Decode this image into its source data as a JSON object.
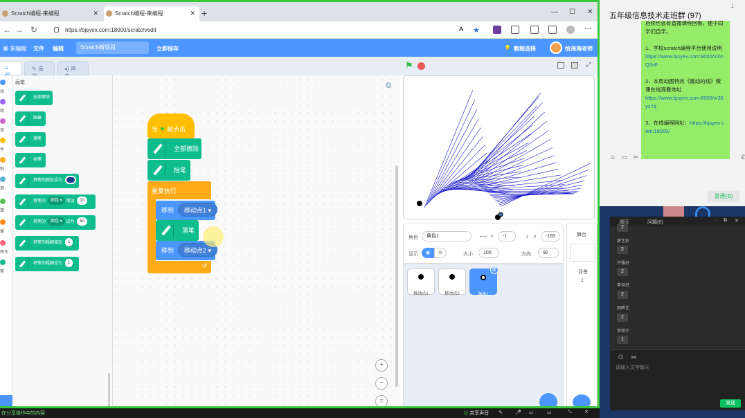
{
  "browser": {
    "tab1_title": "Scratch编程-来编程",
    "tab2_title": "Scratch编程-来编程",
    "url": "https://bjsyex.com:18000/scratch/edit"
  },
  "menubar": {
    "file": "文件",
    "edit": "编辑",
    "project_title": "Scratch新项目",
    "save_now": "立即保存",
    "tutorials": "教程选择",
    "user": "恰海海老师"
  },
  "tabs": {
    "code": "代码",
    "costumes": "造型",
    "sounds": "声音"
  },
  "categories": [
    "动",
    "观",
    "音",
    "件",
    "制",
    "测",
    "算",
    "量",
    "积木",
    "笔"
  ],
  "palette": {
    "heading": "画笔",
    "blocks": [
      {
        "text": "全部擦除"
      },
      {
        "text": "图章"
      },
      {
        "text": "落笔"
      },
      {
        "text": "抬笔"
      },
      {
        "text": "将笔的颜色设为"
      },
      {
        "text": "将笔的",
        "dd": "颜色",
        "mid": "增加",
        "val": "10"
      },
      {
        "text": "将笔的",
        "dd": "颜色",
        "mid": "设为",
        "val": "50"
      },
      {
        "text": "将笔的粗细增加",
        "val": "1"
      },
      {
        "text": "将笔的粗细设为",
        "val": "1"
      }
    ]
  },
  "script": {
    "hat": {
      "when": "当",
      "clicked": "被点击"
    },
    "clear": "全部擦除",
    "pen_up": "抬笔",
    "forever": "重复执行",
    "goto1": {
      "label": "移到",
      "target": "移动点1"
    },
    "pen_down": "落笔",
    "goto2": {
      "label": "移到",
      "target": "移动点2"
    }
  },
  "sprite_info": {
    "sprite_label": "角色",
    "sprite_name": "角色1",
    "x_label": "x",
    "x": "-1",
    "y_label": "y",
    "y": "-165",
    "show_label": "显示",
    "size_label": "大小",
    "size": "100",
    "direction_label": "方向",
    "direction": "90"
  },
  "sprites": [
    "移动点1",
    "移动点2",
    "角色1"
  ],
  "stage_pane": {
    "title": "舞台",
    "backdrops_label": "背景",
    "backdrops_count": "1"
  },
  "taskbar": {
    "status": "在分享操作中的内容",
    "share_sound": "共享声音"
  },
  "chat": {
    "title": "五年级信息技术走班群 (97)",
    "bubble_top": "后续也会有直播课程回看，便于同学们自学。",
    "item1": "1、学校scratch编程平台使用说明",
    "link1": "https://www.bjsyex.com:8000/v/nnQ3vF",
    "item2": "2、本周动图特效《跳动的线》微课在线观看地址",
    "link2": "https://www.bjsyex.com:8000/v/J6yz7q",
    "item3": "3、在线编程网址：",
    "link3": "https://bjsyex.com:18000/",
    "send": "发送(S)"
  },
  "live_panel": {
    "tab_chat": "聊天",
    "tab_questions": "问题(0)",
    "messages": [
      {
        "name": "",
        "value": "2"
      },
      {
        "name": "廖艺杉",
        "value": "2"
      },
      {
        "name": "许雅舒",
        "value": "2"
      },
      {
        "name": "李悦然",
        "value": "2"
      },
      {
        "name": "颜晞艺",
        "value": "2"
      },
      {
        "name": "李续宁",
        "value": "1"
      }
    ],
    "input_placeholder": "请输入文字聊天",
    "send": "发送"
  }
}
